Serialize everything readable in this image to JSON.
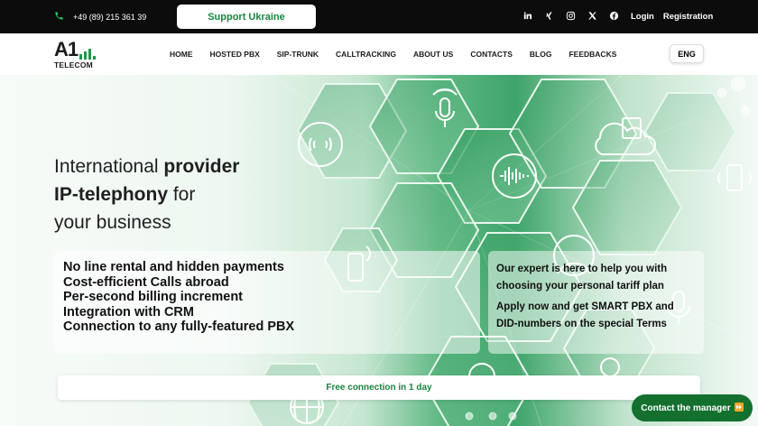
{
  "topbar": {
    "phone": "+49 (89) 215 361 39",
    "support_label": "Support Ukraine",
    "socials": [
      "linkedin-icon",
      "xing-icon",
      "instagram-icon",
      "x-icon",
      "facebook-icon"
    ],
    "login": "Login",
    "registration": "Registration"
  },
  "logo": {
    "mark": "A1",
    "name": "TELECOM"
  },
  "nav": {
    "items": [
      "HOME",
      "HOSTED PBX",
      "SIP-TRUNK",
      "CALLTRACKING",
      "ABOUT US",
      "CONTACTS",
      "BLOG",
      "FEEDBACKS"
    ],
    "lang": "ENG"
  },
  "hero": {
    "line1_normal": "International ",
    "line1_bold": "provider",
    "line2_bold": "IP-telephony",
    "line2_normal": " for",
    "line3": "your business",
    "features": [
      "No line rental and hidden payments",
      "Cost-efficient Calls abroad",
      "Per-second billing increment",
      "Integration with CRM",
      "Connection to any fully-featured PBX"
    ],
    "expert_p1": "Our expert is here to help you with choosing your personal tariff plan",
    "expert_p2": "Apply now and get SMART PBX and DID-numbers on the special Terms",
    "free_connection": "Free connection in 1 day"
  },
  "manager_button": "Contact the manager",
  "colors": {
    "brand_green": "#17853f",
    "dark_green": "#13702f",
    "topbar": "#0c0c0c"
  }
}
